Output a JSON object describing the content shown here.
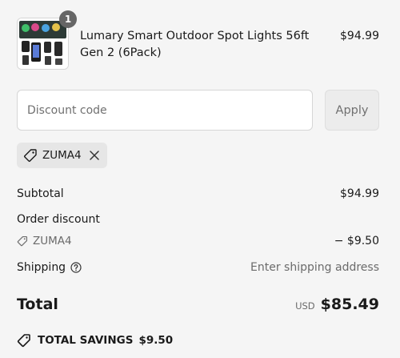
{
  "product": {
    "title": "Lumary Smart Outdoor Spot Lights 56ft Gen 2 (6Pack)",
    "price": "$94.99",
    "quantity": "1"
  },
  "discount": {
    "placeholder": "Discount code",
    "value": "",
    "apply_label": "Apply",
    "applied_code": "ZUMA4",
    "tag_icon": "tag-icon",
    "remove_icon": "close-icon"
  },
  "summary": {
    "subtotal_label": "Subtotal",
    "subtotal_value": "$94.99",
    "order_discount_label": "Order discount",
    "order_discount_code": "ZUMA4",
    "order_discount_value": "− $9.50",
    "shipping_label": "Shipping",
    "shipping_help_icon": "question-circle-icon",
    "shipping_value": "Enter shipping address",
    "total_label": "Total",
    "currency": "USD",
    "total_value": "$85.49",
    "savings_label": "TOTAL SAVINGS",
    "savings_value": "$9.50"
  },
  "colors": {
    "background": "#f5f5f5",
    "text": "#1a1a1a",
    "muted_text": "#6b6b6b",
    "badge": "#666666",
    "chip": "#e6e6e6",
    "border": "#d6d6d6"
  }
}
